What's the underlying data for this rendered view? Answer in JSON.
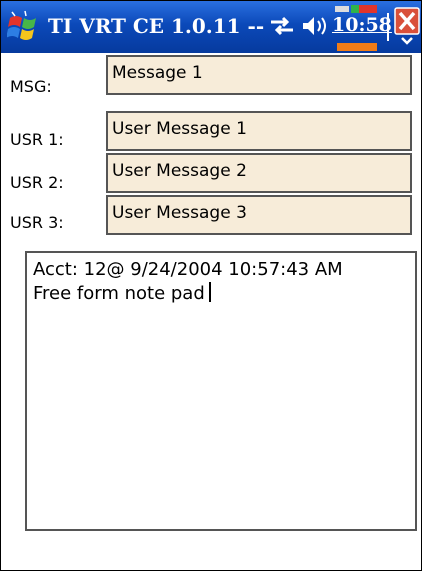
{
  "titlebar": {
    "title": "TI VRT CE 1.0.11 --",
    "clock": "10:58",
    "colors": {
      "bar": "#0b49b9",
      "battery_indicator": "#f07c18"
    }
  },
  "form": {
    "msg_label": "MSG:",
    "msg_value": "Message 1",
    "usr1_label": "USR 1:",
    "usr1_value": "User Message 1",
    "usr2_label": "USR 2:",
    "usr2_value": "User Message 2",
    "usr3_label": "USR 3:",
    "usr3_value": "User Message 3",
    "field_color": "#f7ecd9"
  },
  "notepad": {
    "line1": "Acct: 12@ 9/24/2004 10:57:43 AM",
    "line2": "Free form note pad"
  },
  "icons": [
    "windows-start-icon",
    "connectivity-icon",
    "volume-icon",
    "battery-icon",
    "close-icon"
  ]
}
